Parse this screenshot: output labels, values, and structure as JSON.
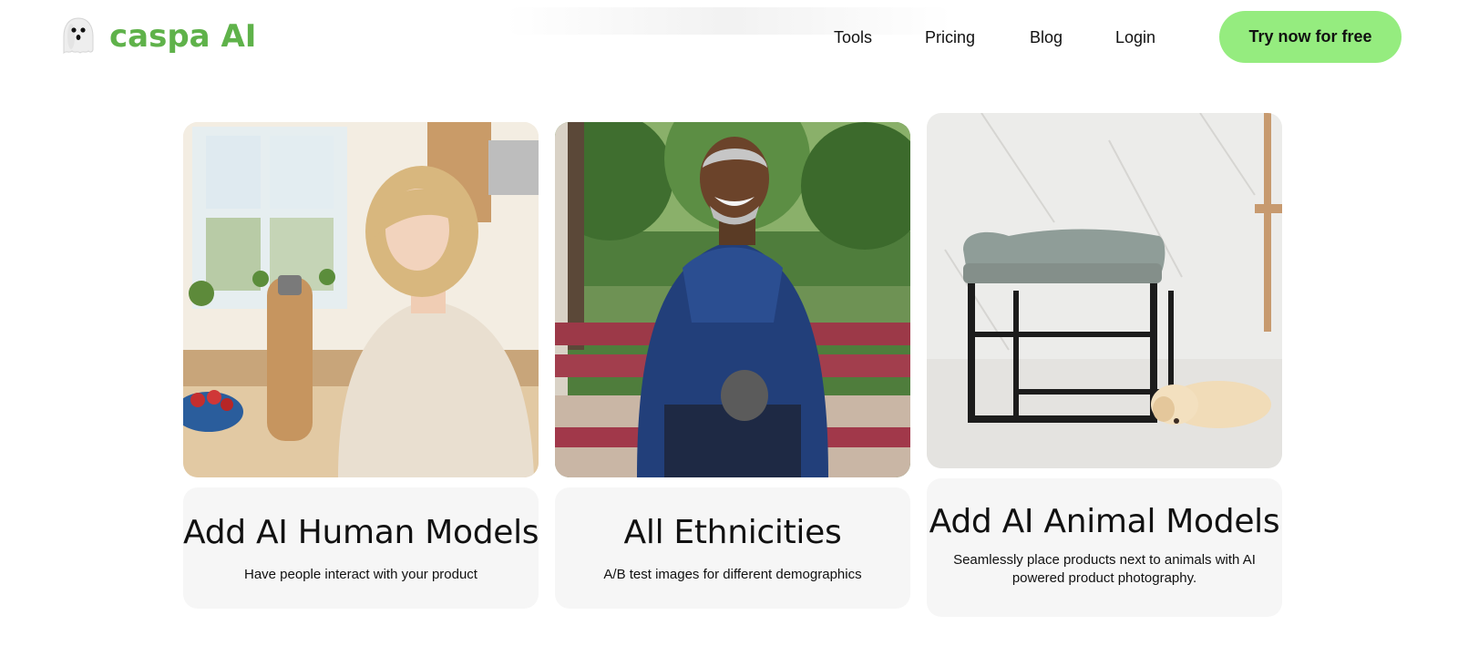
{
  "brand": {
    "name": "caspa AI",
    "logo_icon": "ghost-icon",
    "color": "#5fb24a"
  },
  "nav": {
    "items": [
      {
        "label": "Tools"
      },
      {
        "label": "Pricing"
      },
      {
        "label": "Blog"
      },
      {
        "label": "Login"
      }
    ],
    "cta": {
      "label": "Try now for free",
      "color": "#95ec7f"
    }
  },
  "cards": [
    {
      "image": "woman-kitchen-water-bottle",
      "title": "Add AI Human Models",
      "description": "Have people interact with your product"
    },
    {
      "image": "man-park-bench",
      "title": "All Ethnicities",
      "description": "A/B test images for different demographics"
    },
    {
      "image": "ottoman-with-puppy",
      "title": "Add AI Animal Models",
      "description": "Seamlessly place products next to animals with AI powered product photography."
    }
  ]
}
